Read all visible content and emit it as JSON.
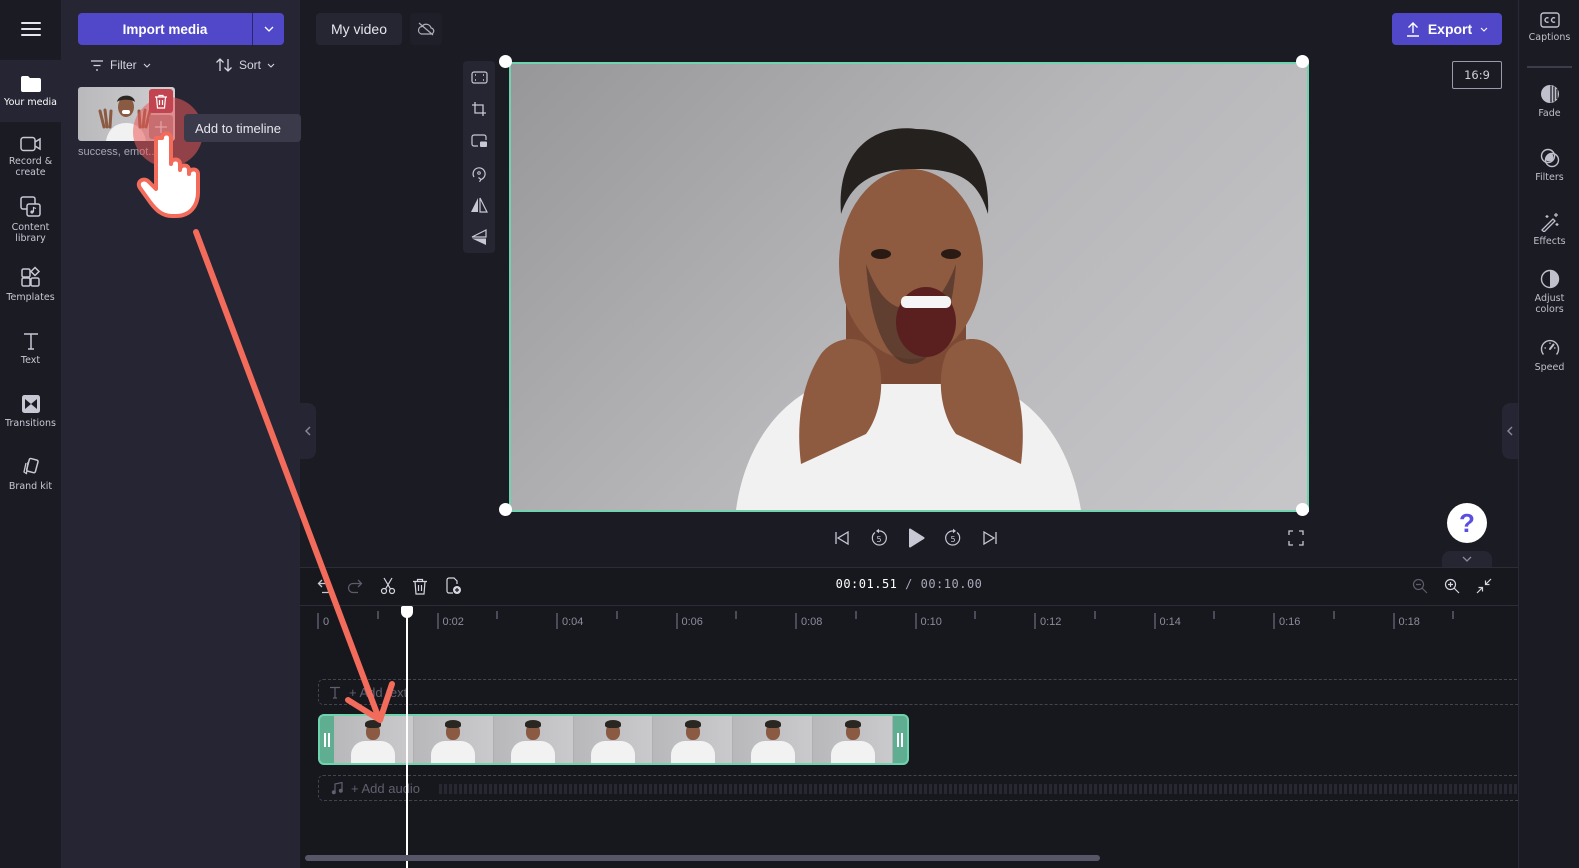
{
  "left_nav": {
    "menu_icon": "hamburger-menu-icon",
    "items": [
      {
        "label": "Your media",
        "icon": "folder-icon",
        "active": true
      },
      {
        "label": "Record & create",
        "icon": "camera-icon"
      },
      {
        "label": "Content library",
        "icon": "content-library-icon"
      },
      {
        "label": "Templates",
        "icon": "templates-icon"
      },
      {
        "label": "Text",
        "icon": "text-icon"
      },
      {
        "label": "Transitions",
        "icon": "transitions-icon"
      },
      {
        "label": "Brand kit",
        "icon": "brand-kit-icon"
      }
    ]
  },
  "media_panel": {
    "import_label": "Import media",
    "filter_label": "Filter",
    "sort_label": "Sort",
    "media_items": [
      {
        "label": "success, emot...",
        "selected": true
      }
    ],
    "tooltip": "Add to timeline"
  },
  "header": {
    "project_title": "My video",
    "cloud_status_icon": "cloud-off-icon",
    "export_label": "Export",
    "aspect_ratio": "16:9"
  },
  "canvas_tools": [
    "fit-icon",
    "crop-icon",
    "picture-in-picture-icon",
    "rotate-icon",
    "flip-horizontal-icon",
    "flip-vertical-icon"
  ],
  "right_panel": {
    "items": [
      {
        "label": "Captions",
        "icon": "captions-icon"
      },
      {
        "label": "Fade",
        "icon": "fade-icon"
      },
      {
        "label": "Filters",
        "icon": "filters-icon"
      },
      {
        "label": "Effects",
        "icon": "effects-icon"
      },
      {
        "label": "Adjust colors",
        "icon": "adjust-colors-icon"
      },
      {
        "label": "Speed",
        "icon": "speed-icon"
      }
    ]
  },
  "playback": {
    "skip_back_seconds": "5",
    "skip_forward_seconds": "5"
  },
  "help_label": "?",
  "timeline": {
    "current_time": "00:01.51",
    "separator": " / ",
    "total_time": "00:10.00",
    "ruler_labels": [
      "0",
      "0:02",
      "0:04",
      "0:06",
      "0:08",
      "0:10",
      "0:12",
      "0:14",
      "0:16",
      "0:18"
    ],
    "add_text_label": "+ Add text",
    "add_audio_label": "+ Add audio",
    "clip_frame_count": 7,
    "playhead_seconds": 1.51
  },
  "colors": {
    "accent": "#5048c8",
    "selection": "#6fd3ad",
    "annotation": "#f26b5b",
    "delete": "#c24450"
  }
}
